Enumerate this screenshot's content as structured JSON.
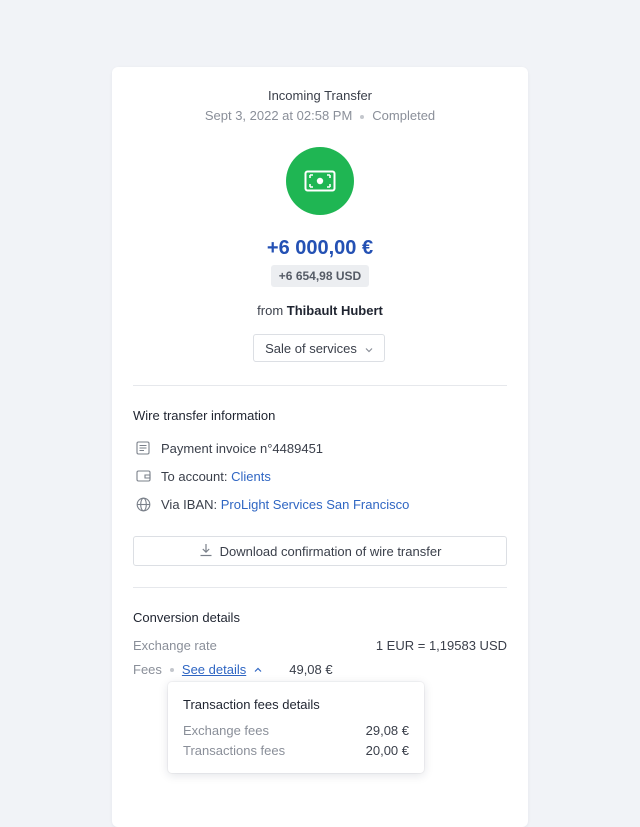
{
  "header": {
    "title": "Incoming Transfer",
    "date": "Sept 3, 2022 at 02:58 PM",
    "status": "Completed"
  },
  "colors": {
    "accent": "#2451b4",
    "success": "#1fb653",
    "link": "#2f66c3"
  },
  "icon": "banknote-icon",
  "amount": {
    "primary": "+6 000,00 €",
    "secondary": "+6 654,98 USD"
  },
  "sender": {
    "prefix": "from",
    "name": "Thibault Hubert"
  },
  "category": {
    "label": "Sale of services"
  },
  "wire": {
    "title": "Wire transfer information",
    "invoice": "Payment invoice n°4489451",
    "account_prefix": "To account:",
    "account": "Clients",
    "iban_prefix": "Via IBAN:",
    "iban": "ProLight Services San Francisco",
    "download_label": "Download confirmation of wire transfer"
  },
  "conversion": {
    "title": "Conversion details",
    "rate_label": "Exchange rate",
    "rate_value": "1 EUR = 1,19583 USD",
    "fees_label": "Fees",
    "see_details": "See details",
    "fees_value": "49,08 €"
  },
  "fees_popover": {
    "title": "Transaction fees details",
    "rows": [
      {
        "label": "Exchange fees",
        "value": "29,08 €"
      },
      {
        "label": "Transactions fees",
        "value": "20,00 €"
      }
    ]
  }
}
